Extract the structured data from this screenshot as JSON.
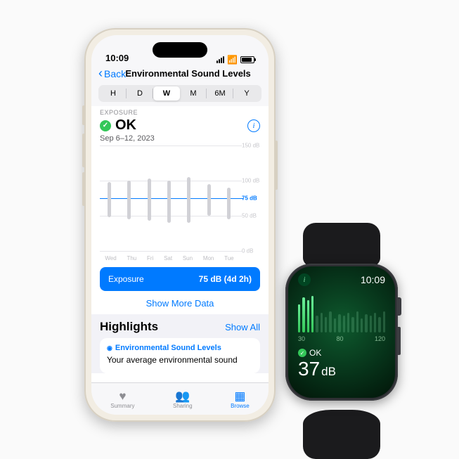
{
  "phone": {
    "time": "10:09",
    "back_label": "Back",
    "title": "Environmental Sound Levels",
    "segments": [
      "H",
      "D",
      "W",
      "M",
      "6M",
      "Y"
    ],
    "segment_selected": "W",
    "exposure_label": "EXPOSURE",
    "status": "OK",
    "date_range": "Sep 6–12, 2023",
    "exposure_card_label": "Exposure",
    "exposure_card_value": "75 dB (4d 2h)",
    "show_more": "Show More Data",
    "highlights_title": "Highlights",
    "show_all": "Show All",
    "hl_card_title": "Environmental Sound Levels",
    "hl_card_text": "Your average environmental sound",
    "tabs": {
      "summary": "Summary",
      "sharing": "Sharing",
      "browse": "Browse"
    }
  },
  "watch": {
    "time": "10:09",
    "scale": {
      "min": "30",
      "mid": "80",
      "max": "120"
    },
    "status": "OK",
    "value": "37",
    "unit": "dB"
  },
  "chart_data": {
    "type": "bar",
    "categories": [
      "Wed",
      "Thu",
      "Fri",
      "Sat",
      "Sun",
      "Mon",
      "Tue"
    ],
    "series": [
      {
        "name": "range_low",
        "values": [
          48,
          45,
          43,
          40,
          40,
          50,
          45
        ]
      },
      {
        "name": "range_high",
        "values": [
          98,
          100,
          103,
          100,
          105,
          95,
          90
        ]
      }
    ],
    "reference_line": 75,
    "ylabel": "dB",
    "ylim": [
      0,
      150
    ],
    "y_ticks": [
      0,
      50,
      75,
      100,
      150
    ],
    "y_tick_labels": [
      "0 dB",
      "50 dB",
      "75 dB",
      "100 dB",
      "150 dB"
    ]
  },
  "watch_bars": {
    "active_count": 4,
    "total_count": 20,
    "heights": [
      40,
      50,
      46,
      52,
      24,
      28,
      22,
      30,
      20,
      26,
      24,
      28,
      22,
      30,
      20,
      26,
      24,
      28,
      22,
      30
    ]
  }
}
